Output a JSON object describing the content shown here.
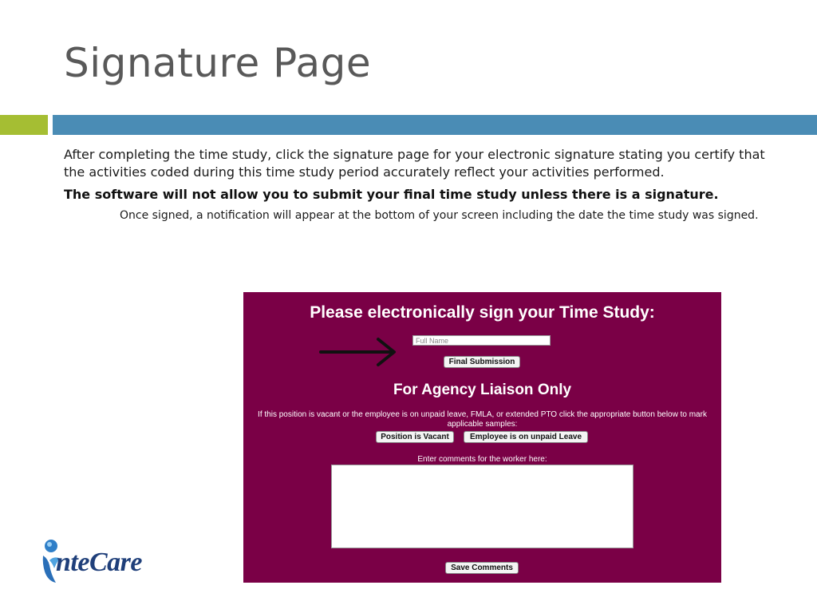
{
  "slide": {
    "title": "Signature Page",
    "paragraph1": "After completing the time study, click the signature page for your electronic signature stating  you certify that the activities coded during this time study period accurately reflect your  activities performed.",
    "paragraph2": "The software will not allow you to submit your final time study unless there is a  signature.",
    "paragraph3": "Once signed, a notification will appear at the bottom of  your screen including the date the time study was signed."
  },
  "form": {
    "heading": "Please electronically sign your Time Study:",
    "name_placeholder": "Full Name",
    "final_submission_label": "Final Submission",
    "liaison_heading": "For Agency Liaison Only",
    "vacant_instructions": "If this position is vacant or the employee is on unpaid leave, FMLA, or extended PTO click the appropriate button below to mark applicable samples:",
    "vacant_button_label": "Position is Vacant",
    "unpaid_leave_button_label": "Employee is on unpaid Leave",
    "comments_label": "Enter comments for the worker here:",
    "save_comments_label": "Save Comments",
    "panel_color": "#7a0046"
  },
  "logo": {
    "text": "nteCare",
    "icon": "intecare-person-icon"
  },
  "colors": {
    "accent_green": "#a5be33",
    "accent_blue": "#4a8cb5",
    "title_gray": "#595959"
  }
}
